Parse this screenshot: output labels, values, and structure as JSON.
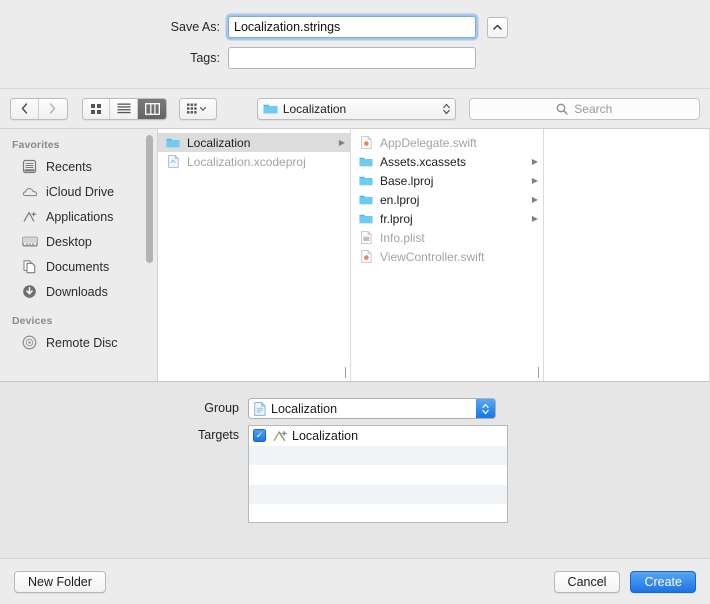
{
  "header": {
    "save_as_label": "Save As:",
    "save_as_value": "Localization.strings",
    "tags_label": "Tags:",
    "tags_value": "",
    "tags_placeholder": "",
    "expand_icon": "chevron-up-icon"
  },
  "toolbar": {
    "back_icon": "chevron-left-icon",
    "forward_icon": "chevron-right-icon",
    "view_icon_grid": "icon-view-icon",
    "view_list": "list-view-icon",
    "view_column": "column-view-icon",
    "arrange_icon": "arrange-grid-icon",
    "arrange_chevron": "chevron-down-icon",
    "path_label": "Localization",
    "path_icon": "folder-icon",
    "path_chevrons": "chevron-up-down-icon",
    "search_icon": "search-icon",
    "search_placeholder": "Search"
  },
  "sidebar": {
    "sections": [
      {
        "title": "Favorites",
        "items": [
          {
            "label": "Recents",
            "icon": "recents-icon"
          },
          {
            "label": "iCloud Drive",
            "icon": "cloud-icon"
          },
          {
            "label": "Applications",
            "icon": "applications-icon"
          },
          {
            "label": "Desktop",
            "icon": "desktop-icon"
          },
          {
            "label": "Documents",
            "icon": "documents-icon"
          },
          {
            "label": "Downloads",
            "icon": "downloads-icon"
          }
        ]
      },
      {
        "title": "Devices",
        "items": [
          {
            "label": "Remote Disc",
            "icon": "disc-icon"
          }
        ]
      }
    ]
  },
  "browser": {
    "column1": [
      {
        "name": "Localization",
        "icon": "folder-icon",
        "selected": true,
        "dim": false,
        "arrow": true
      },
      {
        "name": "Localization.xcodeproj",
        "icon": "xcodeproj-icon",
        "selected": false,
        "dim": true,
        "arrow": false
      }
    ],
    "column2": [
      {
        "name": "AppDelegate.swift",
        "icon": "swift-file-icon",
        "selected": false,
        "dim": true,
        "arrow": false
      },
      {
        "name": "Assets.xcassets",
        "icon": "folder-icon",
        "selected": false,
        "dim": false,
        "arrow": true
      },
      {
        "name": "Base.lproj",
        "icon": "folder-icon",
        "selected": false,
        "dim": false,
        "arrow": true
      },
      {
        "name": "en.lproj",
        "icon": "folder-icon",
        "selected": false,
        "dim": false,
        "arrow": true
      },
      {
        "name": "fr.lproj",
        "icon": "folder-icon",
        "selected": false,
        "dim": false,
        "arrow": true
      },
      {
        "name": "Info.plist",
        "icon": "plist-file-icon",
        "selected": false,
        "dim": true,
        "arrow": false
      },
      {
        "name": "ViewController.swift",
        "icon": "swift-file-icon",
        "selected": false,
        "dim": true,
        "arrow": false
      }
    ],
    "column3": []
  },
  "accessory": {
    "group_label": "Group",
    "group_value": "Localization",
    "group_icon": "file-icon",
    "targets_label": "Targets",
    "targets": [
      {
        "name": "Localization",
        "checked": true,
        "icon": "xcode-app-icon"
      }
    ]
  },
  "footer": {
    "new_folder_label": "New Folder",
    "cancel_label": "Cancel",
    "create_label": "Create"
  },
  "colors": {
    "accent_blue": "#1c74e4",
    "window_bg": "#ececec",
    "accessory_bg": "#e6e6e6",
    "folder_blue": "#5ec0ef",
    "selection_gray": "#dcdcdc"
  }
}
